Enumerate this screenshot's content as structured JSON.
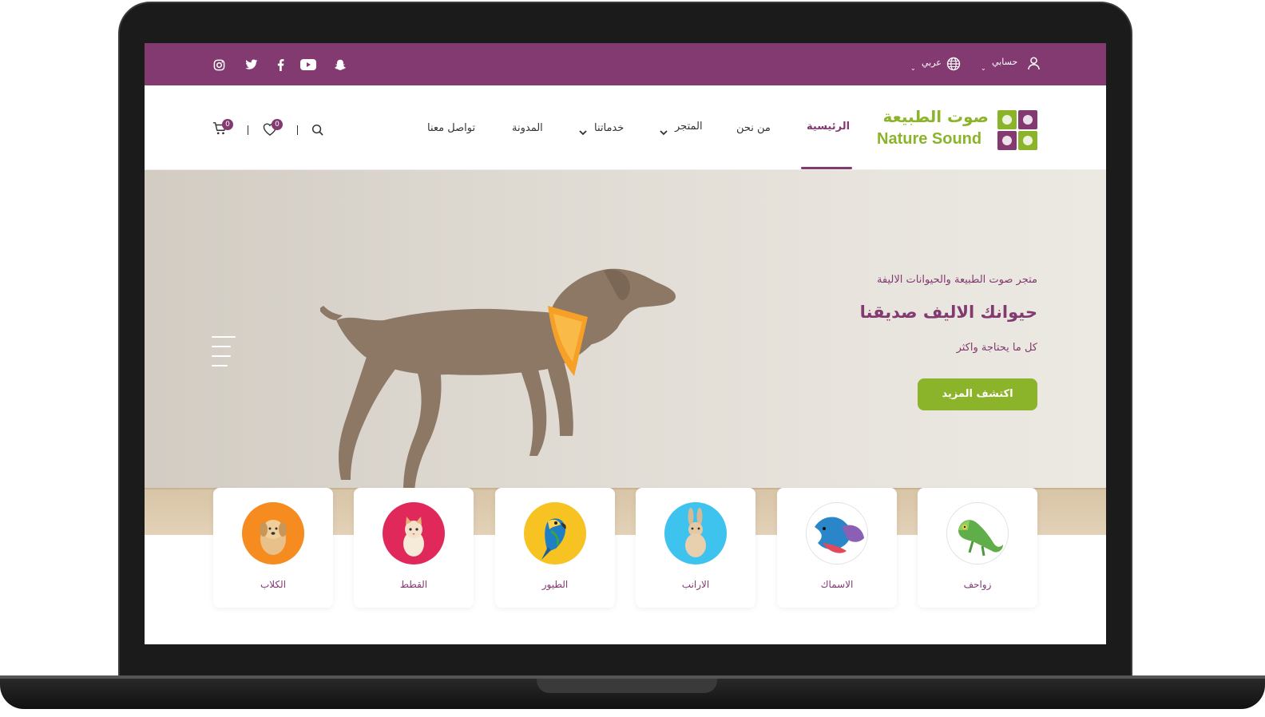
{
  "topbar": {
    "account_label": "حسابي",
    "language_label": "عربي",
    "social": [
      "instagram-icon",
      "twitter-icon",
      "facebook-icon",
      "youtube-icon",
      "snapchat-icon"
    ]
  },
  "brand": {
    "name_ar": "صوت الطبيعة",
    "name_en": "Nature Sound"
  },
  "nav": {
    "items": [
      {
        "label": "الرئيسية",
        "active": true
      },
      {
        "label": "من نحن"
      },
      {
        "label": "المتجر",
        "dropdown": true
      },
      {
        "label": "خدماتنا",
        "dropdown": true
      },
      {
        "label": "المدونة"
      },
      {
        "label": "تواصل معنا"
      }
    ],
    "wishlist_count": "0",
    "cart_count": "0",
    "separator": "|"
  },
  "hero": {
    "kicker": "متجر صوت الطبيعة والحيوانات الاليفة",
    "title": "حيوانك الاليف صديقنا",
    "subtitle": "كل ما يحتاجة واكثر",
    "cta_label": "اكتشف المزيد"
  },
  "categories": [
    {
      "label": "الكلاب",
      "color": "#f68b1f"
    },
    {
      "label": "القطط",
      "color": "#e0285a"
    },
    {
      "label": "الطيور",
      "color": "#f7c322"
    },
    {
      "label": "الارانب",
      "color": "#3dc3ee"
    },
    {
      "label": "الاسماك",
      "color": "#ffffff"
    },
    {
      "label": "زواحف",
      "color": "#ffffff"
    }
  ],
  "colors": {
    "primary": "#823a71",
    "accent": "#8cb42a"
  }
}
